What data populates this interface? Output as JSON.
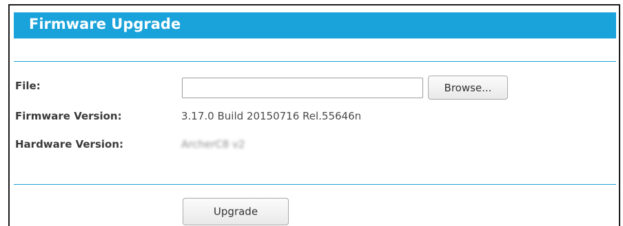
{
  "panel": {
    "title": "Firmware Upgrade"
  },
  "form": {
    "file_label": "File:",
    "file_value": "",
    "browse_label": "Browse...",
    "firmware_label": "Firmware Version:",
    "firmware_value": "3.17.0 Build 20150716 Rel.55646n",
    "hardware_label": "Hardware Version:",
    "hardware_value": "ArcherC8 v2"
  },
  "actions": {
    "upgrade_label": "Upgrade"
  },
  "colors": {
    "accent": "#1aa3da",
    "title_text": "#ffffff",
    "label_text": "#3a3a3a"
  }
}
